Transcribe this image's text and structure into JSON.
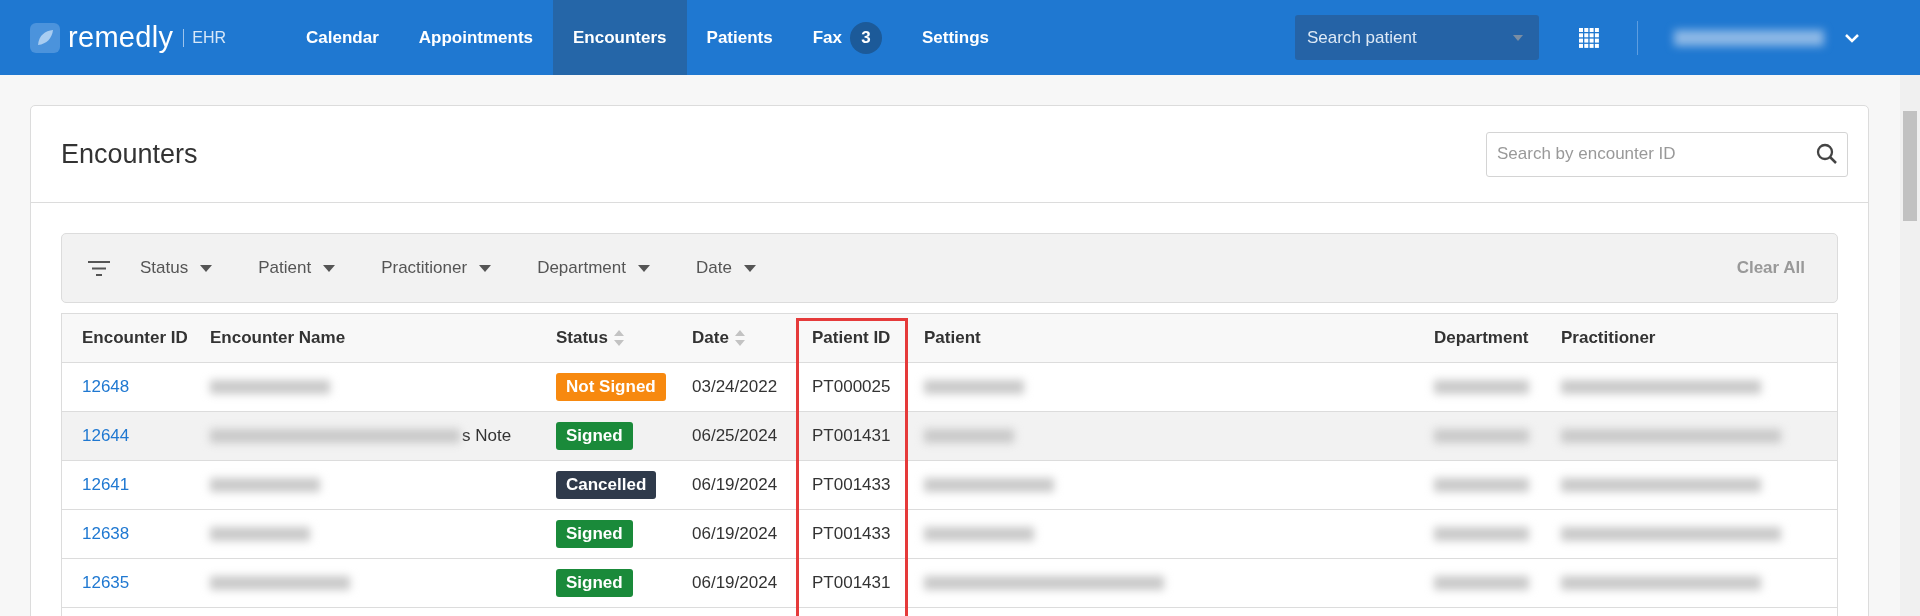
{
  "app": {
    "logo": "remedly",
    "product": "EHR"
  },
  "nav": [
    {
      "label": "Calendar",
      "selected": false
    },
    {
      "label": "Appointments",
      "selected": false
    },
    {
      "label": "Encounters",
      "selected": true
    },
    {
      "label": "Patients",
      "selected": false
    },
    {
      "label": "Fax",
      "selected": false,
      "badge": "3"
    },
    {
      "label": "Settings",
      "selected": false
    }
  ],
  "patient_search": {
    "placeholder": "Search patient"
  },
  "page": {
    "title": "Encounters",
    "search": {
      "placeholder": "Search by encounter ID"
    }
  },
  "filters": [
    {
      "label": "Status"
    },
    {
      "label": "Patient"
    },
    {
      "label": "Practitioner"
    },
    {
      "label": "Department"
    },
    {
      "label": "Date"
    }
  ],
  "clear_all": "Clear All",
  "table": {
    "columns": [
      {
        "label": "Encounter ID",
        "sortable": false,
        "highlighted": false
      },
      {
        "label": "Encounter Name",
        "sortable": false,
        "highlighted": false
      },
      {
        "label": "Status",
        "sortable": true,
        "highlighted": false
      },
      {
        "label": "Date",
        "sortable": true,
        "highlighted": false
      },
      {
        "label": "Patient ID",
        "sortable": false,
        "highlighted": true
      },
      {
        "label": "Patient",
        "sortable": false,
        "highlighted": false
      },
      {
        "label": "Department",
        "sortable": false,
        "highlighted": false
      },
      {
        "label": "Practitioner",
        "sortable": false,
        "highlighted": false
      }
    ],
    "rows": [
      {
        "id": "12648",
        "status": "Not Signed",
        "color": "#f7890f",
        "date": "03/24/2022",
        "patient_id": "PT000025",
        "hovered": false
      },
      {
        "id": "12644",
        "name_tail": "s Note",
        "status": "Signed",
        "color": "#1a8a3a",
        "date": "06/25/2024",
        "patient_id": "PT001431",
        "hovered": true
      },
      {
        "id": "12641",
        "status": "Cancelled",
        "color": "#2f3a4b",
        "date": "06/19/2024",
        "patient_id": "PT001433",
        "hovered": false
      },
      {
        "id": "12638",
        "status": "Signed",
        "color": "#1a8a3a",
        "date": "06/19/2024",
        "patient_id": "PT001433",
        "hovered": false
      },
      {
        "id": "12635",
        "status": "Signed",
        "color": "#1a8a3a",
        "date": "06/19/2024",
        "patient_id": "PT001431",
        "hovered": false
      }
    ]
  }
}
